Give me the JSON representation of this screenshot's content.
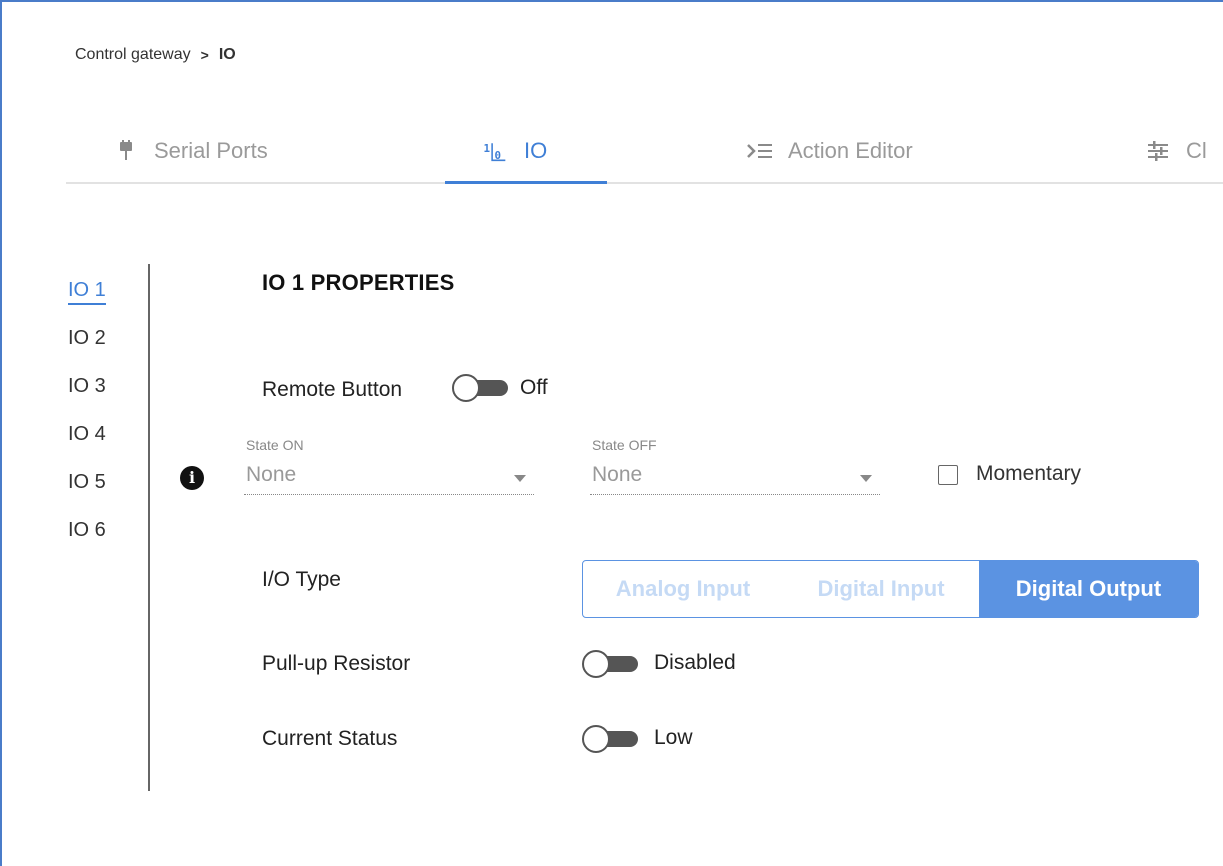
{
  "breadcrumb": {
    "parent": "Control gateway",
    "separator": ">",
    "current": "IO"
  },
  "tabs": [
    {
      "label": "Serial Ports",
      "icon": "plug-icon"
    },
    {
      "label": "IO",
      "icon": "io-icon",
      "active": true
    },
    {
      "label": "Action Editor",
      "icon": "action-editor-icon"
    },
    {
      "label": "Cl",
      "icon": "sliders-icon"
    }
  ],
  "side_nav": {
    "items": [
      "IO 1",
      "IO 2",
      "IO 3",
      "IO 4",
      "IO 5",
      "IO 6"
    ],
    "active_index": 0
  },
  "properties": {
    "title": "IO 1 PROPERTIES",
    "remote_button": {
      "label": "Remote Button",
      "state": "Off"
    },
    "state_on": {
      "label": "State ON",
      "value": "None"
    },
    "state_off": {
      "label": "State OFF",
      "value": "None"
    },
    "momentary": {
      "label": "Momentary",
      "checked": false
    },
    "io_type": {
      "label": "I/O Type",
      "options": [
        "Analog Input",
        "Digital Input",
        "Digital Output"
      ],
      "selected": "Digital Output"
    },
    "pullup": {
      "label": "Pull-up Resistor",
      "state": "Disabled"
    },
    "current_status": {
      "label": "Current Status",
      "state": "Low"
    }
  },
  "colors": {
    "accent": "#3f7fd6",
    "segment_active": "#5b93e2",
    "segment_inactive_text": "#c5daf5"
  }
}
